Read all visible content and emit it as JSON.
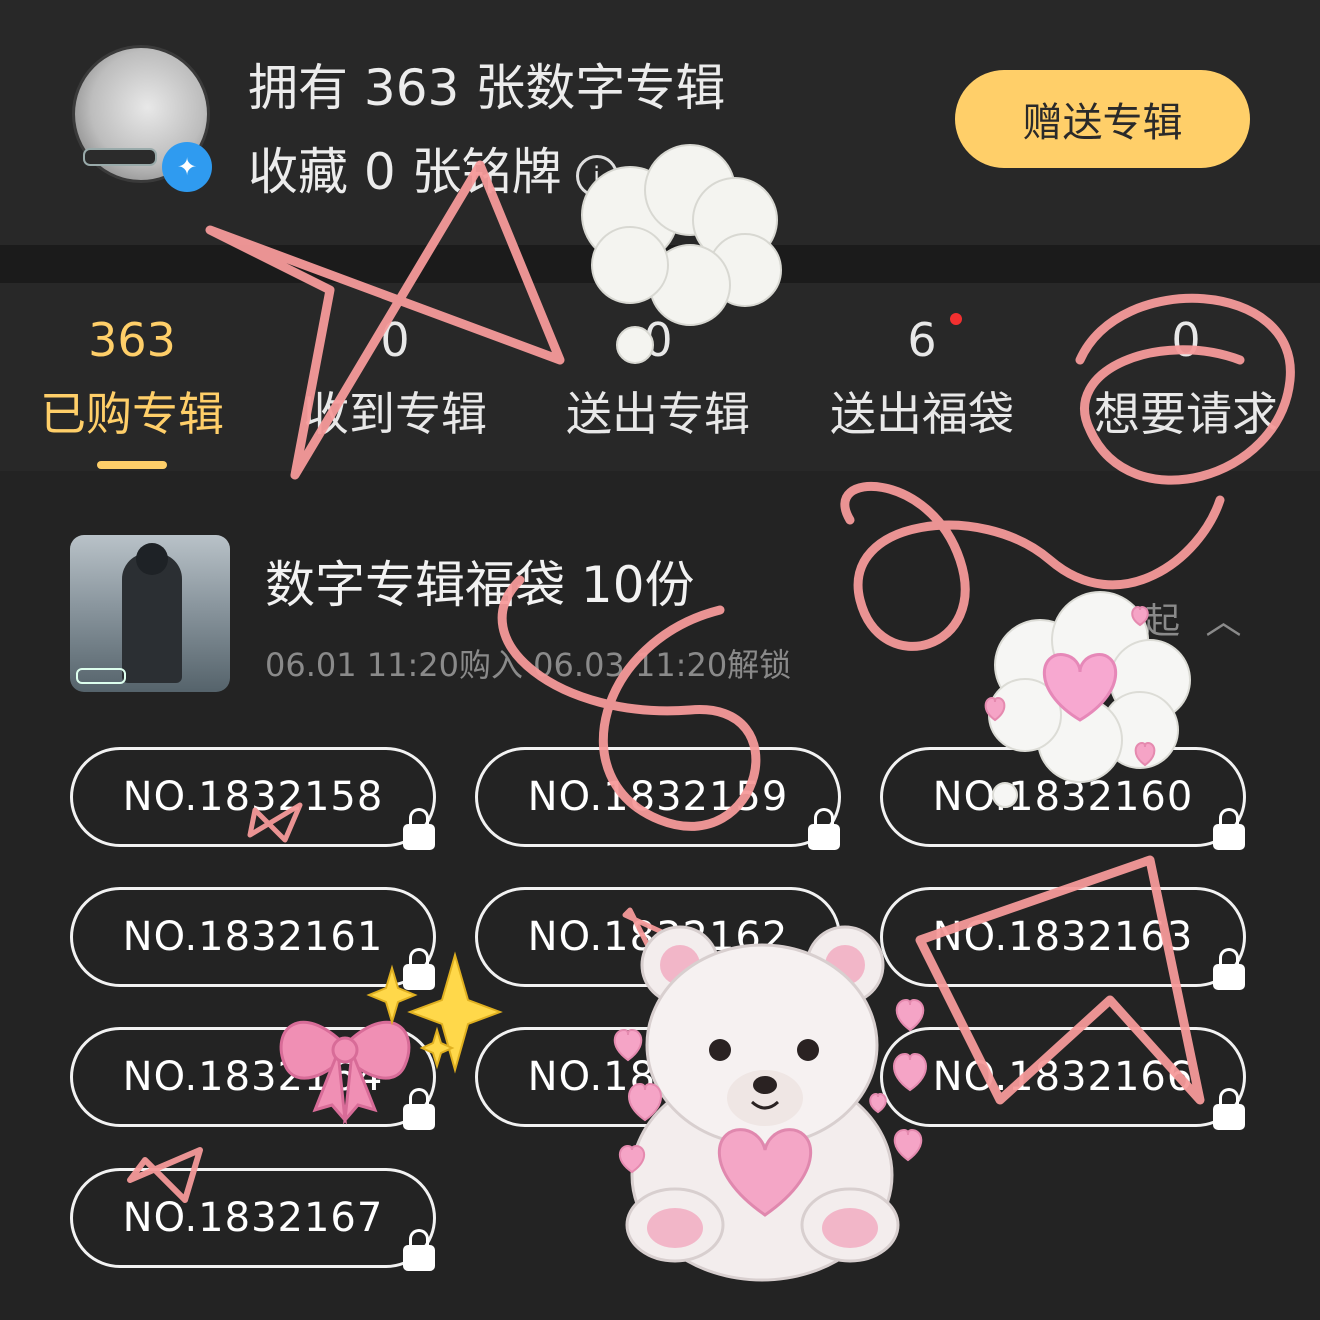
{
  "header": {
    "owned_text": "拥有 363 张数字专辑",
    "collected_text": "收藏 0 张铭牌",
    "info_icon": "i",
    "gift_button": "赠送专辑"
  },
  "tabs": [
    {
      "count": "363",
      "label": "已购专辑",
      "active": true
    },
    {
      "count": "0",
      "label": "收到专辑"
    },
    {
      "count": "0",
      "label": "送出专辑"
    },
    {
      "count": "6",
      "label": "送出福袋",
      "has_red_dot": true
    },
    {
      "count": "0",
      "label": "想要请求"
    }
  ],
  "pack": {
    "title": "数字专辑福袋 10份",
    "time": "06.01 11:20购入 06.03 11:20解锁",
    "collapse_label": "收起",
    "collapse_icon": "chevron-up-icon"
  },
  "items": [
    "NO.1832158",
    "NO.1832159",
    "NO.1832160",
    "NO.1832161",
    "NO.1832162",
    "NO.1832163",
    "NO.1832164",
    "NO.1832165",
    "NO.1832166",
    "NO.1832167"
  ],
  "colors": {
    "accent": "#ffcf69",
    "background": "#232323",
    "overlay_scribble": "#f59a9a"
  }
}
